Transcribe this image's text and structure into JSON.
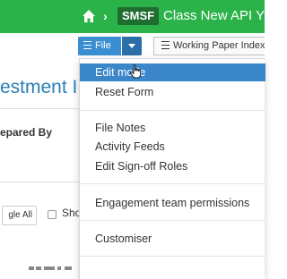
{
  "header": {
    "badge": "SMSF",
    "client_name": "Class New API Y",
    "chevron": "›",
    "colors": {
      "bar": "#2bb34a",
      "badge": "#1e6e2f"
    }
  },
  "toolbar": {
    "file_label": "File",
    "working_paper_label": "Working Paper Index"
  },
  "page": {
    "title_fragment": "estment I",
    "prepared_by_fragment": "epared By",
    "toggle_fragment": "gle All",
    "show_fragment": "Sho"
  },
  "menu": {
    "items": [
      {
        "label": "Edit mode",
        "active": true
      },
      {
        "label": "Reset Form"
      },
      {
        "label": "File Notes"
      },
      {
        "label": "Activity Feeds"
      },
      {
        "label": "Edit Sign-off Roles"
      },
      {
        "label": "Engagement team permissions"
      },
      {
        "label": "Customiser"
      }
    ],
    "accent": "#3a86c8"
  }
}
